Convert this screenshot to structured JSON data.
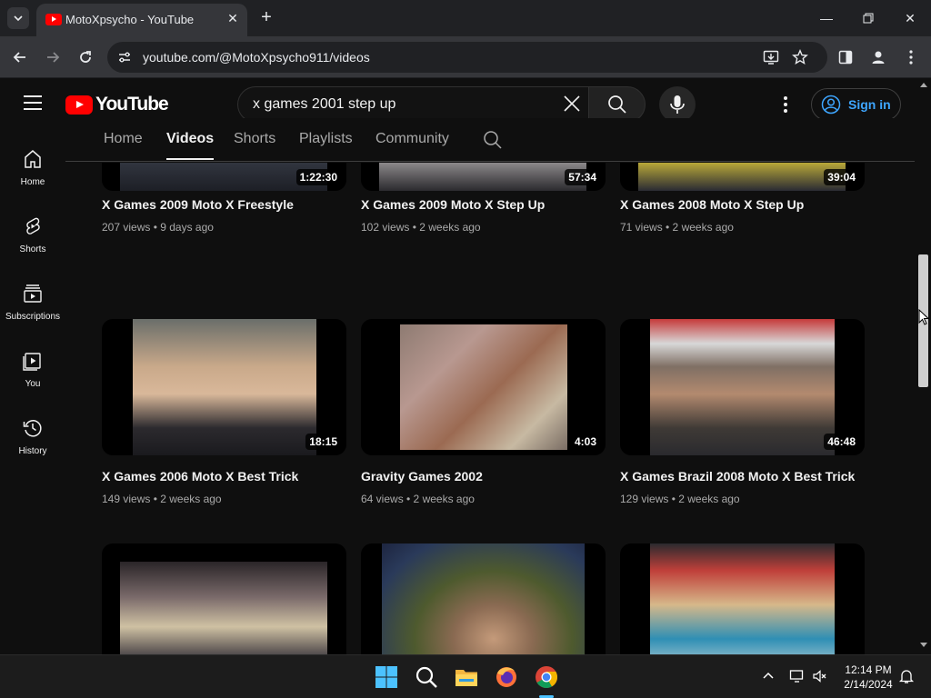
{
  "browser": {
    "tab_title": "MotoXpsycho - YouTube",
    "url": "youtube.com/@MotoXpsycho911/videos"
  },
  "header": {
    "logo_text": "YouTube",
    "search_value": "x games 2001 step up",
    "sign_in_label": "Sign in"
  },
  "sidebar": {
    "items": [
      {
        "label": "Home",
        "icon": "home-icon"
      },
      {
        "label": "Shorts",
        "icon": "shorts-icon"
      },
      {
        "label": "Subscriptions",
        "icon": "subscriptions-icon"
      },
      {
        "label": "You",
        "icon": "you-icon"
      },
      {
        "label": "History",
        "icon": "history-icon"
      }
    ]
  },
  "channel_tabs": [
    {
      "label": "Home",
      "active": false
    },
    {
      "label": "Videos",
      "active": true
    },
    {
      "label": "Shorts",
      "active": false
    },
    {
      "label": "Playlists",
      "active": false
    },
    {
      "label": "Community",
      "active": false
    }
  ],
  "videos": [
    {
      "title": "X Games 2009 Moto X Freestyle",
      "meta": "207 views • 9 days ago",
      "duration": "1:22:30"
    },
    {
      "title": "X Games 2009 Moto X Step Up",
      "meta": "102 views • 2 weeks ago",
      "duration": "57:34"
    },
    {
      "title": "X Games 2008 Moto X Step Up",
      "meta": "71 views • 2 weeks ago",
      "duration": "39:04"
    },
    {
      "title": "X Games 2006 Moto X Best Trick",
      "meta": "149 views • 2 weeks ago",
      "duration": "18:15"
    },
    {
      "title": "Gravity Games 2002",
      "meta": "64 views • 2 weeks ago",
      "duration": "4:03"
    },
    {
      "title": "X Games Brazil 2008 Moto X Best Trick",
      "meta": "129 views • 2 weeks ago",
      "duration": "46:48"
    },
    {
      "title": "",
      "meta": "",
      "duration": ""
    },
    {
      "title": "",
      "meta": "",
      "duration": ""
    },
    {
      "title": "",
      "meta": "",
      "duration": ""
    }
  ],
  "taskbar": {
    "time": "12:14 PM",
    "date": "2/14/2024"
  },
  "colors": {
    "background": "#0f0f0f",
    "youtube_red": "#ff0000",
    "link_blue": "#3ea6ff"
  }
}
